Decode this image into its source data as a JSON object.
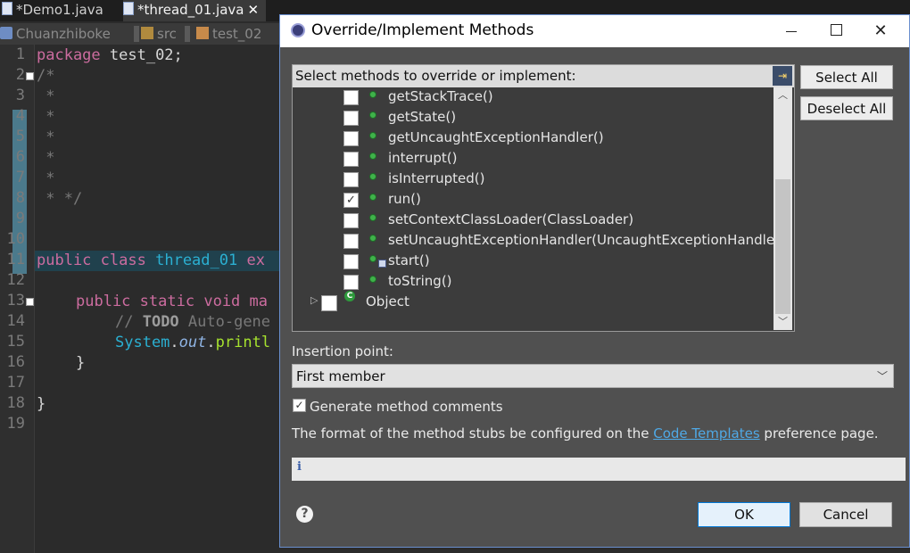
{
  "editor": {
    "tabs": [
      {
        "label": "*Demo1.java"
      },
      {
        "label": "*thread_01.java",
        "close": "✕"
      }
    ],
    "breadcrumbs": [
      "Chuanzhiboke",
      "src",
      "test_02"
    ],
    "line_numbers": [
      "1",
      "2",
      "3",
      "4",
      "5",
      "6",
      "7",
      "8",
      "9",
      "10",
      "11",
      "12",
      "13",
      "14",
      "15",
      "16",
      "17",
      "18",
      "19"
    ],
    "code": {
      "l1_kw": "package",
      "l1_rest": " test_02;",
      "l2": "/*",
      "star": " *",
      "l8": " * */",
      "l11_kw1": "public",
      "l11_kw2": "class",
      "l11_name": "thread_01",
      "l11_rest": " ex",
      "l13_kw1": "public",
      "l13_kw2": "static",
      "l13_kw3": "void",
      "l13_rest": " ma",
      "l14_cm": "// ",
      "l14_todo": "TODO",
      "l14_rest": " Auto-gene",
      "l15_cls": "System",
      "l15_dot": ".",
      "l15_fld": "out",
      "l15_dot2": ".",
      "l15_mth": "printl",
      "brace_close": "}"
    }
  },
  "dialog": {
    "title": "Override/Implement Methods",
    "prompt": "Select methods to override or implement:",
    "methods": [
      {
        "name": "getStackTrace()",
        "checked": false
      },
      {
        "name": "getState()",
        "checked": false
      },
      {
        "name": "getUncaughtExceptionHandler()",
        "checked": false
      },
      {
        "name": "interrupt()",
        "checked": false
      },
      {
        "name": "isInterrupted()",
        "checked": false
      },
      {
        "name": "run()",
        "checked": true
      },
      {
        "name": "setContextClassLoader(ClassLoader)",
        "checked": false
      },
      {
        "name": "setUncaughtExceptionHandler(UncaughtExceptionHandler)",
        "checked": false
      },
      {
        "name": "start()",
        "checked": false
      },
      {
        "name": "toString()",
        "checked": false
      }
    ],
    "parent_class": "Object",
    "class_icon_letter": "C",
    "select_all": "Select All",
    "deselect_all": "Deselect All",
    "insertion_label": "Insertion point:",
    "insertion_value": "First member",
    "generate_comments": {
      "label": "Generate method comments",
      "checked": true
    },
    "format_text_before": "The format of the method stubs be configured on the ",
    "format_link": "Code Templates",
    "format_text_after": " preference page.",
    "ok": "OK",
    "cancel": "Cancel",
    "help_icon": "?",
    "info_icon": "i"
  },
  "colors": {
    "accent": "#0078d7",
    "link": "#4fa9e6",
    "method_dot": "#3fb24a"
  }
}
